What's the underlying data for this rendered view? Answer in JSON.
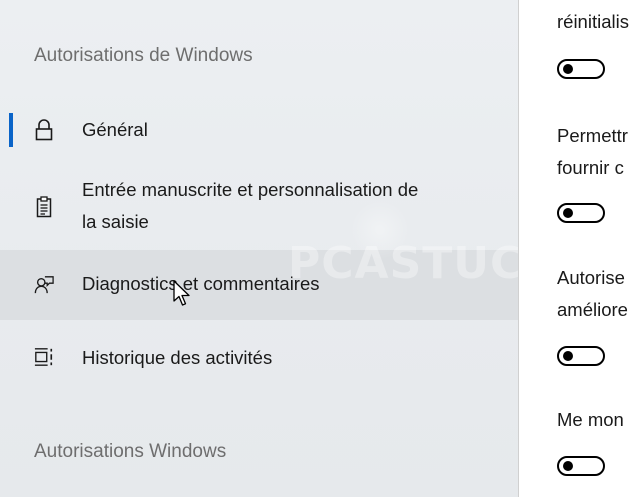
{
  "nav": {
    "section_top": "Autorisations de Windows",
    "items": [
      {
        "label": "Général",
        "icon": "lock-icon",
        "selected": true
      },
      {
        "label_line1": "Entrée manuscrite et personnalisation de",
        "label_line2": "la saisie",
        "icon": "clipboard-icon"
      },
      {
        "label": "Diagnostics et commentaires",
        "icon": "feedback-icon",
        "hovered": true
      },
      {
        "label": "Historique des activités",
        "icon": "timeline-icon"
      }
    ],
    "section_bottom": "Autorisations Windows"
  },
  "watermark": {
    "text": "PCASTUCES"
  },
  "content": {
    "text1": "réinitialis",
    "text2_line1": "Permettr",
    "text2_line2": "fournir c",
    "text3_line1": "Autorise",
    "text3_line2": "améliore",
    "text4": "Me mon",
    "toggles": [
      {
        "state": "off"
      },
      {
        "state": "off"
      },
      {
        "state": "off"
      },
      {
        "state": "off"
      }
    ]
  },
  "colors": {
    "accent": "#0a64c8",
    "nav_bg": "#eceff2",
    "hover_bg": "#dcdfe2",
    "section_text": "#6e6e6e"
  }
}
